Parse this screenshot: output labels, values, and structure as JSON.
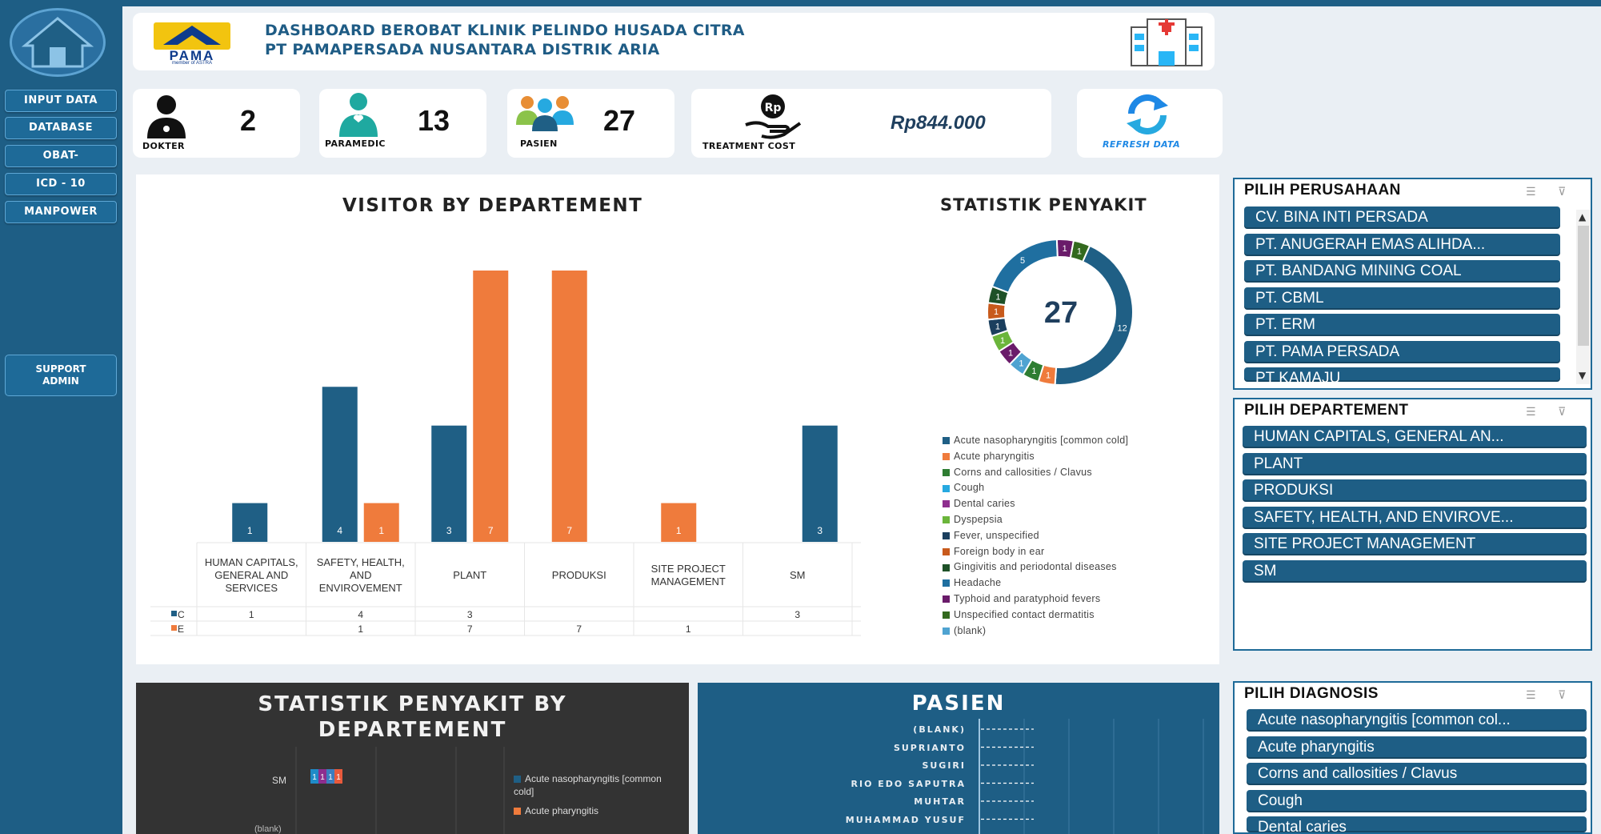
{
  "header": {
    "logo_text": "PAMA",
    "logo_sub": "member of ASTRA",
    "title_line1": "DASHBOARD BEROBAT KLINIK PELINDO HUSADA CITRA",
    "title_line2": "PT PAMAPERSADA NUSANTARA DISTRIK ARIA"
  },
  "sidebar": {
    "items": [
      "INPUT DATA",
      "DATABASE",
      "OBAT-",
      "ICD - 10",
      "MANPOWER"
    ],
    "support": [
      "SUPPORT",
      "ADMIN"
    ]
  },
  "kpis": {
    "dokter": {
      "label": "DOKTER",
      "value": "2"
    },
    "paramedic": {
      "label": "PARAMEDIC",
      "value": "13"
    },
    "pasien": {
      "label": "PASIEN",
      "value": "27"
    },
    "treatment": {
      "label": "TREATMENT COST",
      "value": "Rp844.000"
    },
    "refresh": {
      "label": "REFRESH DATA"
    }
  },
  "colors": {
    "blue": "#1F5F85",
    "orange": "#EF7B3C",
    "navy": "#1E5E85"
  },
  "chart_data": [
    {
      "type": "bar",
      "title": "VISITOR BY DEPARTEMENT",
      "categories": [
        "HUMAN CAPITALS, GENERAL AND SERVICES",
        "SAFETY, HEALTH, AND ENVIROVEMENT",
        "PLANT",
        "PRODUKSI",
        "SITE PROJECT MANAGEMENT",
        "SM"
      ],
      "series": [
        {
          "name": "C",
          "values": [
            1,
            4,
            3,
            null,
            null,
            3
          ]
        },
        {
          "name": "E",
          "values": [
            null,
            1,
            7,
            7,
            1,
            null
          ]
        }
      ],
      "ylim": [
        0,
        7
      ]
    },
    {
      "type": "pie",
      "title": "STATISTIK PENYAKIT",
      "center_label": "27",
      "labels": [
        "Acute nasopharyngitis [common cold]",
        "Acute pharyngitis",
        "Corns and callosities / Clavus",
        "Cough",
        "Dental caries",
        "Dyspepsia",
        "Fever, unspecified",
        "Foreign body in ear",
        "Gingivitis and periodontal diseases",
        "Headache",
        "Typhoid and paratyphoid fevers",
        "Unspecified contact dermatitis",
        "(blank)"
      ],
      "colors": [
        "#1F5F85",
        "#EF7B3C",
        "#2E7D32",
        "#26A9E0",
        "#8E2E8E",
        "#6BB53B",
        "#1B3F5E",
        "#C85A1C",
        "#1E5128",
        "#1F6FA0",
        "#6A1B6A",
        "#33691E",
        "#4FA3D1"
      ],
      "slices": [
        {
          "label": "Acute nasopharyngitis [common cold]",
          "value": 12
        },
        {
          "label": "Acute pharyngitis",
          "value": 1
        },
        {
          "label": "Corns and callosities / Clavus",
          "value": 1
        },
        {
          "label": "(blank)",
          "value": 1
        },
        {
          "label": "Typhoid and paratyphoid fevers",
          "value": 1
        },
        {
          "label": "Dyspepsia",
          "value": 1
        },
        {
          "label": "Fever, unspecified",
          "value": 1
        },
        {
          "label": "Foreign body in ear",
          "value": 1
        },
        {
          "label": "Gingivitis and periodontal diseases",
          "value": 1
        },
        {
          "label": "Headache",
          "value": 5
        },
        {
          "label": "Typhoid and paratyphoid fevers",
          "value": 1
        },
        {
          "label": "Unspecified contact dermatitis",
          "value": 1
        }
      ]
    },
    {
      "type": "bar",
      "title": "STATISTIK PENYAKIT BY DEPARTEMENT",
      "categories": [
        "SM",
        "(blank)"
      ],
      "stack_labels": [
        "1",
        "1",
        "1",
        "1"
      ],
      "legend": [
        "Acute nasopharyngitis [common cold]",
        "Acute pharyngitis"
      ]
    },
    {
      "type": "bar",
      "title": "PASIEN",
      "categories": [
        "(BLANK)",
        "SUPRIANTO",
        "SUGIRI",
        "RIO EDO SAPUTRA",
        "MUHTAR",
        "MUHAMMAD YUSUF"
      ]
    }
  ],
  "slicers": {
    "perusahaan": {
      "title": "PILIH PERUSAHAAN",
      "items": [
        "CV. BINA INTI PERSADA",
        "PT. ANUGERAH EMAS ALIHDA...",
        "PT. BANDANG MINING COAL",
        "PT. CBML",
        "PT. ERM",
        "PT. PAMA PERSADA",
        "PT KAMAJU"
      ]
    },
    "departement": {
      "title": "PILIH DEPARTEMENT",
      "items": [
        "HUMAN CAPITALS, GENERAL AN...",
        "PLANT",
        "PRODUKSI",
        "SAFETY, HEALTH, AND ENVIROVE...",
        "SITE PROJECT MANAGEMENT",
        "SM"
      ]
    },
    "diagnosis": {
      "title": "PILIH DIAGNOSIS",
      "items": [
        "Acute nasopharyngitis [common col...",
        "Acute pharyngitis",
        "Corns and callosities / Clavus",
        "Cough",
        "Dental caries"
      ]
    }
  }
}
